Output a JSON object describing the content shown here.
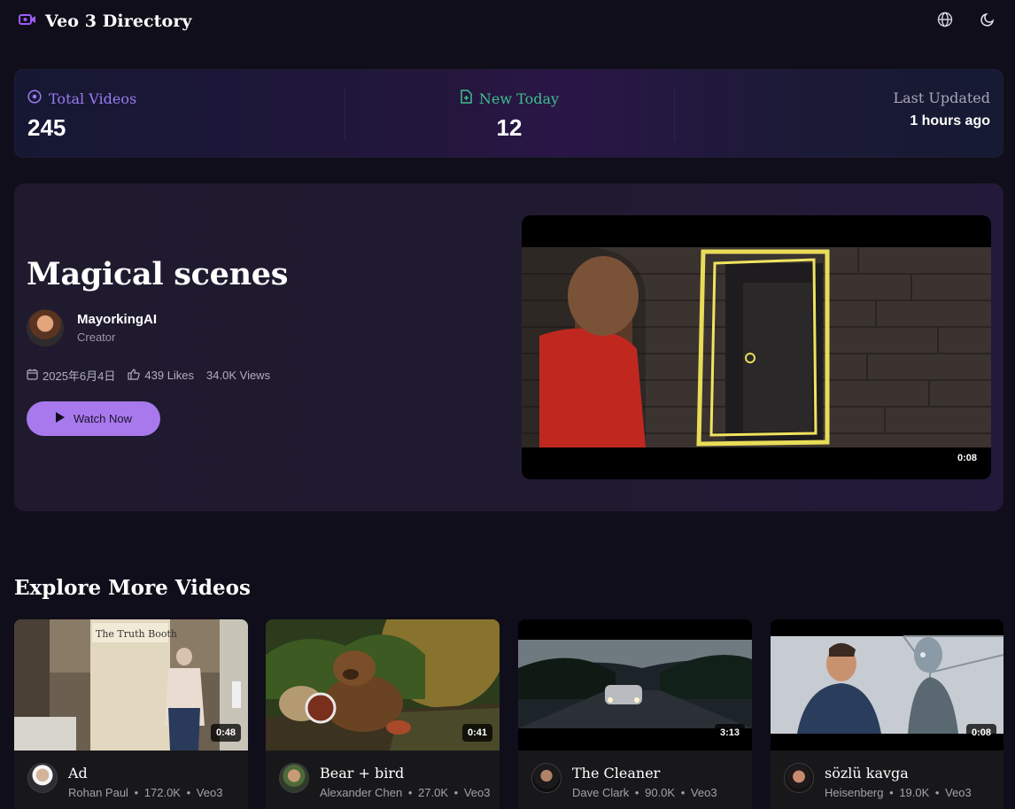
{
  "header": {
    "brand": "Veo 3 Directory",
    "icons": [
      "video-camera-icon",
      "globe-icon",
      "moon-icon"
    ]
  },
  "stats": {
    "total": {
      "label": "Total Videos",
      "value": "245"
    },
    "today": {
      "label": "New Today",
      "value": "12"
    },
    "updated": {
      "label": "Last Updated",
      "value": "1 hours ago"
    },
    "colors": {
      "total": "#9a7cf0",
      "today": "#3fbf8c",
      "updated": "#a9a6b8"
    }
  },
  "featured": {
    "title": "Magical scenes",
    "creator_name": "MayorkingAI",
    "creator_role": "Creator",
    "date": "2025年6月4日",
    "likes": "439 Likes",
    "views": "34.0K Views",
    "watch_label": "Watch Now",
    "duration": "0:08"
  },
  "explore": {
    "title": "Explore More Videos",
    "separator": "•",
    "cards": [
      {
        "title": "Ad",
        "author": "Rohan Paul",
        "views": "172.0K",
        "model": "Veo3",
        "duration": "0:48"
      },
      {
        "title": "Bear + bird",
        "author": "Alexander Chen",
        "views": "27.0K",
        "model": "Veo3",
        "duration": "0:41"
      },
      {
        "title": "The Cleaner",
        "author": "Dave Clark",
        "views": "90.0K",
        "model": "Veo3",
        "duration": "3:13"
      },
      {
        "title": "sözlü kavga",
        "author": "Heisenberg",
        "views": "19.0K",
        "model": "Veo3",
        "duration": "0:08"
      }
    ]
  },
  "theme": {
    "accent": "#a879ec",
    "background": "#100e1a"
  }
}
